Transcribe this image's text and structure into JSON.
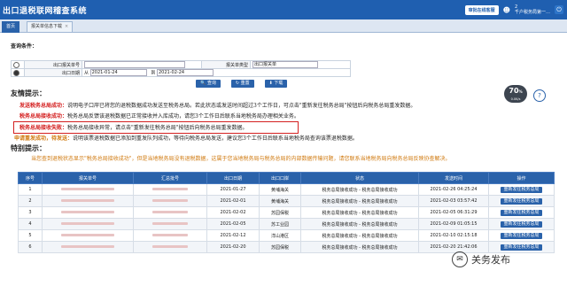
{
  "app": {
    "title": "出口退税联网稽查系统"
  },
  "topbar": {
    "status_button": "审批在线客服",
    "user_line1": "2",
    "user_line2": "千户税务局第一…"
  },
  "tabs": [
    {
      "label": "首页"
    },
    {
      "label": "报关单信息下载",
      "close": "×"
    }
  ],
  "query": {
    "title": "查询条件：",
    "label_customs_no": "出口报关单号",
    "label_customs_type": "报关单类型",
    "customs_type_value": "出口报关单",
    "label_export_date": "出口日期",
    "date_from_label": "从",
    "date_from": "2021-01-24",
    "date_to_label": "到",
    "date_to": "2021-02-24",
    "btn_search": "查询",
    "btn_reset": "重置",
    "btn_download": "下载"
  },
  "tips": {
    "title": "友情提示：",
    "line1_head": "发送税务总局成功：",
    "line1_text": "说明电子口岸已将您的退税数据成功发送至税务总局。若此状态或发送时间超过3个工作日，可点击\"重新发往税务总局\"按钮后向税务总局重发数据。",
    "line2_head": "税务总局接收成功：",
    "line2_text": "税务总局反馈该退税数据已正常接收并入库成功，请您3个工作日后联系当地税务局办理相关业务。",
    "line3_head": "税务总局接收失败：",
    "line3_text": "税务总局接收异常，请点击\"重新发往税务总局\"按钮后向税务总局重发数据。",
    "line4_head": "申请重发成功，待发送：",
    "line4_text": "说明该票退税数据已添加到重发队列成功，等待向税务总局发送，建议您3个工作日后联系当地税务局查询该票退税数据。"
  },
  "special": {
    "title": "特别提示：",
    "text": "当您查到退税状态显示\"税务总局接收成功\"，但是当地税务局没有退税数据，这属于您当地税务局与税务总局的内部数据传输问题，请您联系当地税务局向税务总局反映协查解决。"
  },
  "table": {
    "headers": [
      "序号",
      "报关单号",
      "汇总批号",
      "出口日期",
      "出口口岸",
      "状态",
      "发送时间",
      "操作"
    ],
    "rows": [
      {
        "no": "1",
        "date": "2021-01-27",
        "port": "黄埔海关",
        "status": "税务总局接收成功 - 税务总局接收成功",
        "time": "2021-02-26 04:25:24",
        "op": "重新发往税务总局"
      },
      {
        "no": "2",
        "date": "2021-02-01",
        "port": "黄埔海关",
        "status": "税务总局接收成功 - 税务总局接收成功",
        "time": "2021-02-03 03:57:42",
        "op": "重新发往税务总局"
      },
      {
        "no": "3",
        "date": "2021-02-02",
        "port": "苏园保税",
        "status": "税务总局接收成功 - 税务总局接收成功",
        "time": "2021-02-05 06:31:29",
        "op": "重新发往税务总局"
      },
      {
        "no": "4",
        "date": "2021-02-05",
        "port": "苏工业园",
        "status": "税务总局接收成功 - 税务总局接收成功",
        "time": "2021-02-09 01:05:15",
        "op": "重新发往税务总局"
      },
      {
        "no": "5",
        "date": "2021-02-12",
        "port": "洋山港区",
        "status": "税务总局接收成功 - 税务总局接收成功",
        "time": "2021-02-10 02:15:18",
        "op": "重新发往税务总局"
      },
      {
        "no": "6",
        "date": "2021-02-20",
        "port": "苏园保税",
        "status": "税务总局接收成功 - 税务总局接收成功",
        "time": "2021-02-20 21:42:06",
        "op": "重新发往税务总局"
      }
    ]
  },
  "speed_widget": {
    "percent": "70",
    "unit": "%",
    "rate": "0.0K/s"
  },
  "help_icon": {
    "glyph": "?"
  },
  "watermark": {
    "text": "关务发布"
  }
}
